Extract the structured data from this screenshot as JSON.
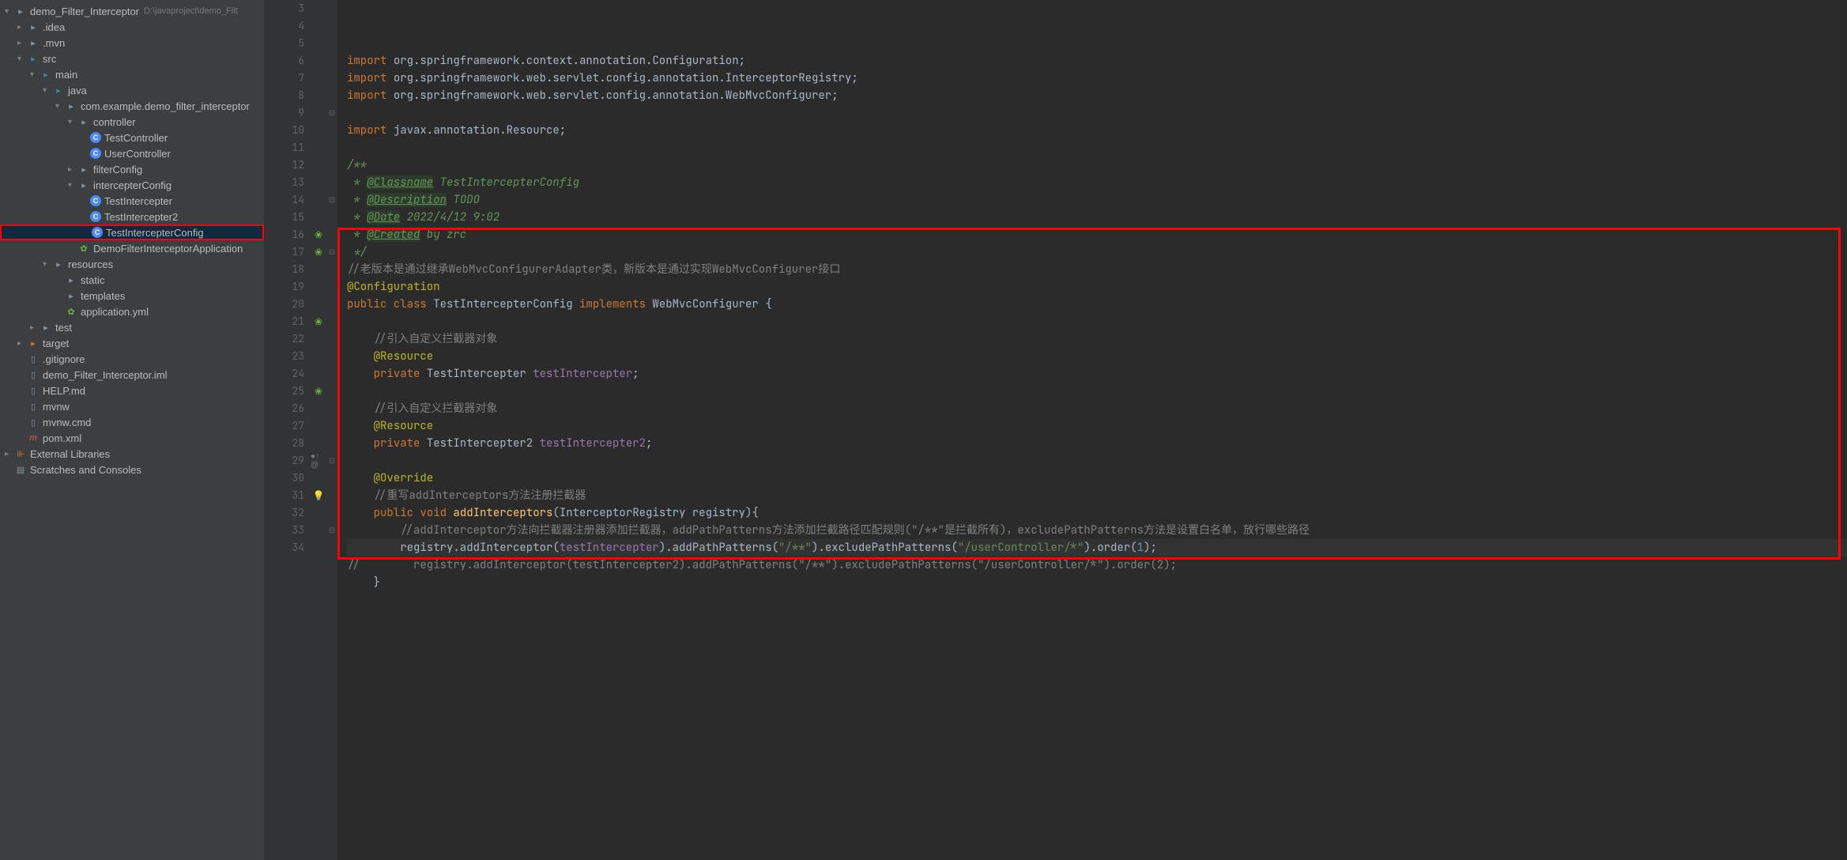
{
  "project": {
    "root": {
      "name": "demo_Filter_Interceptor",
      "path": "D:\\javaproject\\demo_Filt"
    },
    "tree": [
      {
        "level": 0,
        "arrow": "open",
        "icon": "folder",
        "label": "demo_Filter_Interceptor",
        "path": "D:\\javaproject\\demo_Filt"
      },
      {
        "level": 1,
        "arrow": "closed",
        "icon": "folder",
        "label": ".idea"
      },
      {
        "level": 1,
        "arrow": "closed",
        "icon": "folder",
        "label": ".mvn"
      },
      {
        "level": 1,
        "arrow": "open",
        "icon": "folder-src",
        "label": "src"
      },
      {
        "level": 2,
        "arrow": "open",
        "icon": "folder-src",
        "label": "main"
      },
      {
        "level": 3,
        "arrow": "open",
        "icon": "folder-src",
        "label": "java"
      },
      {
        "level": 4,
        "arrow": "open",
        "icon": "folder",
        "label": "com.example.demo_filter_interceptor"
      },
      {
        "level": 5,
        "arrow": "open",
        "icon": "folder",
        "label": "controller"
      },
      {
        "level": 6,
        "arrow": "none",
        "icon": "class",
        "label": "TestController"
      },
      {
        "level": 6,
        "arrow": "none",
        "icon": "class",
        "label": "UserController"
      },
      {
        "level": 5,
        "arrow": "closed",
        "icon": "folder",
        "label": "filterConfig"
      },
      {
        "level": 5,
        "arrow": "open",
        "icon": "folder",
        "label": "intercepterConfig"
      },
      {
        "level": 6,
        "arrow": "none",
        "icon": "class",
        "label": "TestIntercepter"
      },
      {
        "level": 6,
        "arrow": "none",
        "icon": "class",
        "label": "TestIntercepter2"
      },
      {
        "level": 6,
        "arrow": "none",
        "icon": "class",
        "label": "TestIntercepterConfig",
        "selected": true,
        "highlighted": true
      },
      {
        "level": 5,
        "arrow": "none",
        "icon": "spring",
        "label": "DemoFilterInterceptorApplication"
      },
      {
        "level": 3,
        "arrow": "open",
        "icon": "folder-resources",
        "label": "resources"
      },
      {
        "level": 4,
        "arrow": "none",
        "icon": "folder",
        "label": "static"
      },
      {
        "level": 4,
        "arrow": "none",
        "icon": "folder",
        "label": "templates"
      },
      {
        "level": 4,
        "arrow": "none",
        "icon": "spring",
        "label": "application.yml"
      },
      {
        "level": 2,
        "arrow": "closed",
        "icon": "folder",
        "label": "test"
      },
      {
        "level": 1,
        "arrow": "closed",
        "icon": "folder-target",
        "label": "target"
      },
      {
        "level": 1,
        "arrow": "none",
        "icon": "file",
        "label": ".gitignore"
      },
      {
        "level": 1,
        "arrow": "none",
        "icon": "file",
        "label": "demo_Filter_Interceptor.iml"
      },
      {
        "level": 1,
        "arrow": "none",
        "icon": "file",
        "label": "HELP.md"
      },
      {
        "level": 1,
        "arrow": "none",
        "icon": "file",
        "label": "mvnw"
      },
      {
        "level": 1,
        "arrow": "none",
        "icon": "file",
        "label": "mvnw.cmd"
      },
      {
        "level": 1,
        "arrow": "none",
        "icon": "maven",
        "label": "pom.xml"
      },
      {
        "level": 0,
        "arrow": "closed",
        "icon": "lib",
        "label": "External Libraries"
      },
      {
        "level": 0,
        "arrow": "none",
        "icon": "scratch",
        "label": "Scratches and Consoles"
      }
    ]
  },
  "editor": {
    "lines": [
      {
        "num": 3,
        "icons": "",
        "fold": "",
        "tokens": [
          {
            "t": "kw",
            "v": "import "
          },
          {
            "t": "type",
            "v": "org.springframework.context.annotation.Configuration;"
          }
        ]
      },
      {
        "num": 4,
        "icons": "",
        "fold": "",
        "tokens": [
          {
            "t": "kw",
            "v": "import "
          },
          {
            "t": "type",
            "v": "org.springframework.web.servlet.config.annotation.InterceptorRegistry;"
          }
        ]
      },
      {
        "num": 5,
        "icons": "",
        "fold": "",
        "tokens": [
          {
            "t": "kw",
            "v": "import "
          },
          {
            "t": "type",
            "v": "org.springframework.web.servlet.config.annotation.WebMvcConfigurer;"
          }
        ]
      },
      {
        "num": 6,
        "icons": "",
        "fold": "",
        "tokens": []
      },
      {
        "num": 7,
        "icons": "",
        "fold": "",
        "tokens": [
          {
            "t": "kw",
            "v": "import "
          },
          {
            "t": "type",
            "v": "javax.annotation.Resource;"
          }
        ]
      },
      {
        "num": 8,
        "icons": "",
        "fold": "",
        "tokens": []
      },
      {
        "num": 9,
        "icons": "",
        "fold": "⊟",
        "tokens": [
          {
            "t": "comment-doc",
            "v": "/**"
          }
        ]
      },
      {
        "num": 10,
        "icons": "",
        "fold": "",
        "tokens": [
          {
            "t": "comment-doc",
            "v": " * "
          },
          {
            "t": "doc-tag",
            "v": "@Classname"
          },
          {
            "t": "comment-doc",
            "v": " TestIntercepterConfig"
          }
        ]
      },
      {
        "num": 11,
        "icons": "",
        "fold": "",
        "tokens": [
          {
            "t": "comment-doc",
            "v": " * "
          },
          {
            "t": "doc-tag",
            "v": "@Description"
          },
          {
            "t": "comment-doc",
            "v": " TODO"
          }
        ]
      },
      {
        "num": 12,
        "icons": "",
        "fold": "",
        "tokens": [
          {
            "t": "comment-doc",
            "v": " * "
          },
          {
            "t": "doc-tag",
            "v": "@Date"
          },
          {
            "t": "comment-doc",
            "v": " 2022/4/12 9:02"
          }
        ]
      },
      {
        "num": 13,
        "icons": "",
        "fold": "",
        "tokens": [
          {
            "t": "comment-doc",
            "v": " * "
          },
          {
            "t": "doc-tag",
            "v": "@Created"
          },
          {
            "t": "comment-doc",
            "v": " by zrc"
          }
        ]
      },
      {
        "num": 14,
        "icons": "",
        "fold": "⊟",
        "tokens": [
          {
            "t": "comment-doc",
            "v": " */"
          }
        ]
      },
      {
        "num": 15,
        "icons": "",
        "fold": "",
        "tokens": [
          {
            "t": "comment",
            "v": "//老版本是通过继承WebMvcConfigurerAdapter类，新版本是通过实现WebMvcConfigurer接口"
          }
        ]
      },
      {
        "num": 16,
        "icons": "leaf",
        "fold": "",
        "tokens": [
          {
            "t": "annotation",
            "v": "@Configuration"
          }
        ]
      },
      {
        "num": 17,
        "icons": "leaf",
        "fold": "⊟",
        "tokens": [
          {
            "t": "kw",
            "v": "public class "
          },
          {
            "t": "type",
            "v": "TestIntercepterConfig "
          },
          {
            "t": "kw",
            "v": "implements "
          },
          {
            "t": "type",
            "v": "WebMvcConfigurer {"
          }
        ]
      },
      {
        "num": 18,
        "icons": "",
        "fold": "",
        "tokens": []
      },
      {
        "num": 19,
        "icons": "",
        "fold": "",
        "tokens": [
          {
            "t": "plain",
            "v": "    "
          },
          {
            "t": "comment",
            "v": "//引入自定义拦截器对象"
          }
        ]
      },
      {
        "num": 20,
        "icons": "",
        "fold": "",
        "tokens": [
          {
            "t": "plain",
            "v": "    "
          },
          {
            "t": "annotation",
            "v": "@Resource"
          }
        ]
      },
      {
        "num": 21,
        "icons": "leaf",
        "fold": "",
        "tokens": [
          {
            "t": "plain",
            "v": "    "
          },
          {
            "t": "kw",
            "v": "private "
          },
          {
            "t": "type",
            "v": "TestIntercepter "
          },
          {
            "t": "field",
            "v": "testIntercepter"
          },
          {
            "t": "plain",
            "v": ";"
          }
        ]
      },
      {
        "num": 22,
        "icons": "",
        "fold": "",
        "tokens": []
      },
      {
        "num": 23,
        "icons": "",
        "fold": "",
        "tokens": [
          {
            "t": "plain",
            "v": "    "
          },
          {
            "t": "comment",
            "v": "//引入自定义拦截器对象"
          }
        ]
      },
      {
        "num": 24,
        "icons": "",
        "fold": "",
        "tokens": [
          {
            "t": "plain",
            "v": "    "
          },
          {
            "t": "annotation",
            "v": "@Resource"
          }
        ]
      },
      {
        "num": 25,
        "icons": "leaf",
        "fold": "",
        "tokens": [
          {
            "t": "plain",
            "v": "    "
          },
          {
            "t": "kw",
            "v": "private "
          },
          {
            "t": "type",
            "v": "TestIntercepter2 "
          },
          {
            "t": "field",
            "v": "testIntercepter2"
          },
          {
            "t": "plain",
            "v": ";"
          }
        ]
      },
      {
        "num": 26,
        "icons": "",
        "fold": "",
        "tokens": []
      },
      {
        "num": 27,
        "icons": "",
        "fold": "",
        "tokens": [
          {
            "t": "plain",
            "v": "    "
          },
          {
            "t": "annotation",
            "v": "@Override"
          }
        ]
      },
      {
        "num": 28,
        "icons": "",
        "fold": "",
        "tokens": [
          {
            "t": "plain",
            "v": "    "
          },
          {
            "t": "comment",
            "v": "//重写addInterceptors方法注册拦截器"
          }
        ]
      },
      {
        "num": 29,
        "icons": "impl",
        "fold": "⊟",
        "tokens": [
          {
            "t": "plain",
            "v": "    "
          },
          {
            "t": "kw",
            "v": "public void "
          },
          {
            "t": "method",
            "v": "addInterceptors"
          },
          {
            "t": "plain",
            "v": "(InterceptorRegistry registry){"
          }
        ]
      },
      {
        "num": 30,
        "icons": "",
        "fold": "",
        "tokens": [
          {
            "t": "plain",
            "v": "        "
          },
          {
            "t": "comment",
            "v": "//addInterceptor方法向拦截器注册器添加拦截器，addPathPatterns方法添加拦截路径匹配规则(\"/**\"是拦截所有)，excludePathPatterns方法是设置白名单，放行哪些路径"
          }
        ]
      },
      {
        "num": 31,
        "icons": "bulb",
        "fold": "",
        "cursor": true,
        "tokens": [
          {
            "t": "plain",
            "v": "        registry.addInterceptor("
          },
          {
            "t": "field",
            "v": "testIntercepter"
          },
          {
            "t": "plain",
            "v": ").addPathPatterns("
          },
          {
            "t": "str",
            "v": "\"/**\""
          },
          {
            "t": "plain",
            "v": ").excludePathPatterns("
          },
          {
            "t": "str",
            "v": "\"/userController/*\""
          },
          {
            "t": "plain",
            "v": ").order("
          },
          {
            "t": "num",
            "v": "1"
          },
          {
            "t": "plain",
            "v": ");"
          }
        ]
      },
      {
        "num": 32,
        "icons": "",
        "fold": "",
        "tokens": [
          {
            "t": "comment",
            "v": "//        registry.addInterceptor(testIntercepter2).addPathPatterns(\"/**\").excludePathPatterns(\"/userController/*\").order(2);"
          }
        ]
      },
      {
        "num": 33,
        "icons": "",
        "fold": "⊟",
        "tokens": [
          {
            "t": "plain",
            "v": "    }"
          }
        ]
      },
      {
        "num": 34,
        "icons": "",
        "fold": "",
        "tokens": []
      }
    ]
  }
}
